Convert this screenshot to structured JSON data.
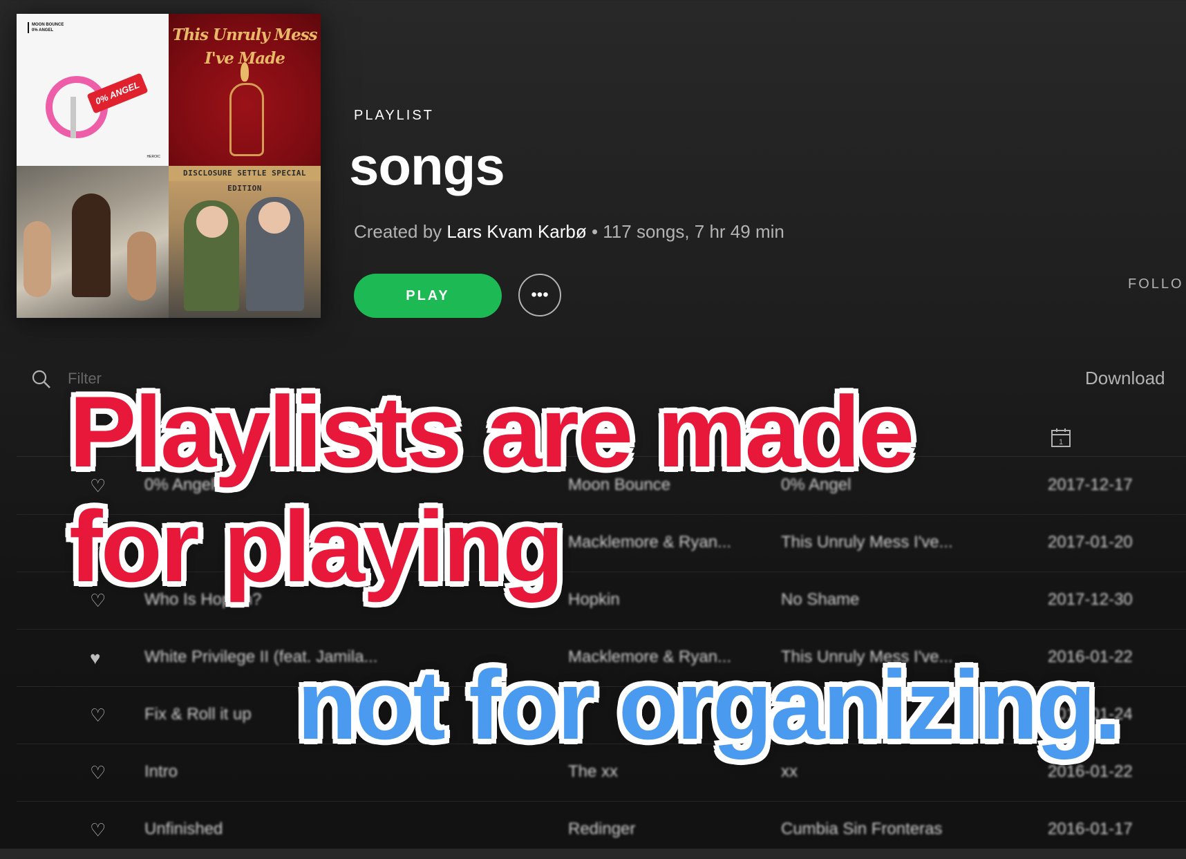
{
  "cover": {
    "tile1_label": "MOON BOUNCE\n0% ANGEL",
    "tile1_tag": "0% ANGEL",
    "tile1_footer": "HEROIC",
    "tile2_title": "This Unruly Mess I've Made",
    "tile4_band": "DISCLOSURE SETTLE SPECIAL EDITION"
  },
  "header": {
    "type_label": "PLAYLIST",
    "title": "songs",
    "created_by_prefix": "Created by",
    "owner": "Lars Kvam Karbø",
    "stats": "• 117 songs, 7 hr 49 min",
    "play_label": "PLAY",
    "more_label": "•••",
    "follow_label": "FOLLO"
  },
  "toolbar": {
    "filter_placeholder": "Filter",
    "download_label": "Download"
  },
  "tracks": [
    {
      "heart": "♡",
      "title": "0% Angel",
      "artist": "Moon Bounce",
      "album": "0% Angel",
      "date": "2017-12-17"
    },
    {
      "heart": "♡",
      "title": "",
      "artist": "Macklemore & Ryan...",
      "album": "This Unruly Mess I've...",
      "date": "2017-01-20"
    },
    {
      "heart": "♡",
      "title": "Who Is Hopkin?",
      "artist": "Hopkin",
      "album": "No Shame",
      "date": "2017-12-30"
    },
    {
      "heart": "♥",
      "title": "White Privilege II (feat. Jamila...",
      "artist": "Macklemore & Ryan...",
      "album": "This Unruly Mess I've...",
      "date": "2016-01-22"
    },
    {
      "heart": "♡",
      "title": "Fix & Roll it up",
      "artist": "",
      "album": "",
      "date": "2016-01-24"
    },
    {
      "heart": "♡",
      "title": "Intro",
      "artist": "The xx",
      "album": "xx",
      "date": "2016-01-22"
    },
    {
      "heart": "♡",
      "title": "Unfinished",
      "artist": "Redinger",
      "album": "Cumbia Sin Fronteras",
      "date": "2016-01-17"
    }
  ],
  "overlay": {
    "line1": "Playlists are made",
    "line2": "for playing",
    "line3": "not for organizing."
  },
  "colors": {
    "play_green": "#1db954",
    "overlay_red": "#e8183a",
    "overlay_blue": "#4a9af0"
  }
}
